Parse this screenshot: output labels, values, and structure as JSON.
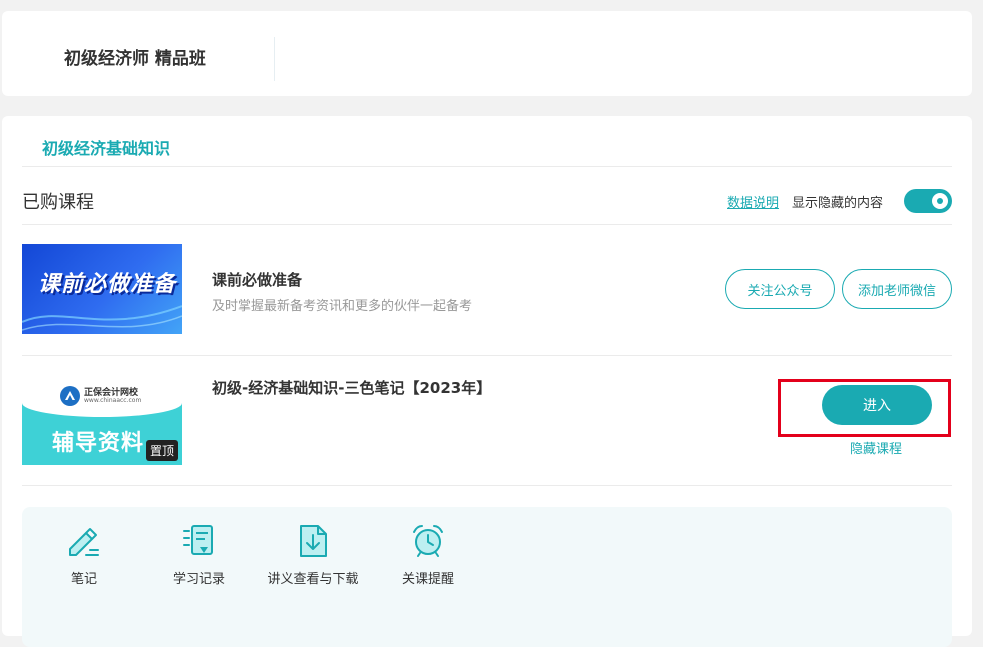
{
  "header": {
    "course_title": "初级经济师 精品班"
  },
  "subject_tab": "初级经济基础知识",
  "purchased": {
    "title": "已购课程",
    "data_link": "数据说明",
    "show_hidden_label": "显示隐藏的内容",
    "show_hidden_on": true
  },
  "courses": [
    {
      "thumb_text": "课前必做准备",
      "title": "课前必做准备",
      "desc": "及时掌握最新备考资讯和更多的伙伴一起备考",
      "buttons": [
        "关注公众号",
        "添加老师微信"
      ]
    },
    {
      "thumb_logo_name": "正保会计网校",
      "thumb_logo_url": "www.chinaacc.com",
      "thumb_text": "辅导资料",
      "pin_badge": "置顶",
      "title": "初级-经济基础知识-三色笔记【2023年】",
      "enter_label": "进入",
      "hide_label": "隐藏课程"
    }
  ],
  "tools": [
    {
      "label": "笔记",
      "icon": "pencil-note-icon"
    },
    {
      "label": "学习记录",
      "icon": "study-record-icon"
    },
    {
      "label": "讲义查看与下载",
      "icon": "download-document-icon"
    },
    {
      "label": "关课提醒",
      "icon": "alarm-clock-icon"
    }
  ],
  "colors": {
    "accent": "#1aaab2",
    "highlight": "#e3001b"
  }
}
